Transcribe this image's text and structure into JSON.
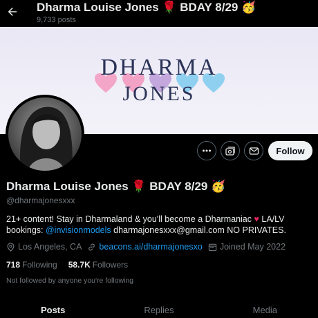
{
  "header": {
    "title": "Dharma Louise Jones 🌹 BDAY 8/29 🥳",
    "posts_count": "9,733 posts"
  },
  "banner": {
    "line1": "DHARMA",
    "line2": "JONES",
    "heart_colors": [
      "#f4a6c8",
      "#f4a6c8",
      "#c3a7dd",
      "#8fd0f0",
      "#8fd0f0"
    ]
  },
  "profile": {
    "display_name": "Dharma Louise Jones 🌹 BDAY 8/29 🥳",
    "handle": "@dharmajonesxxx",
    "bio_part1": "21+ content! Stay in Dharmaland & you'll become a Dharmaniac ",
    "bio_heart": "♥",
    "bio_part2": " LA/LV bookings: ",
    "bio_mention": "@invisionmodels",
    "bio_part3": " dharmajonesxxx@gmail.com NO PRIVATES.",
    "location": "Los Angeles, CA",
    "website": "beacons.ai/dharmajonesxo",
    "joined": "Joined May 2022",
    "following_count": "718",
    "following_label": "Following",
    "followers_count": "58.7K",
    "followers_label": "Followers",
    "not_followed_text": "Not followed by anyone you're following"
  },
  "actions": {
    "follow_label": "Follow",
    "more_icon": "more-icon",
    "subscribe_icon": "subscribe-icon",
    "message_icon": "message-icon"
  },
  "tabs": [
    {
      "label": "Posts",
      "active": true
    },
    {
      "label": "Replies",
      "active": false
    },
    {
      "label": "Media",
      "active": false
    }
  ],
  "colors": {
    "background": "#000000",
    "link": "#1d9bf0",
    "muted": "#71767b",
    "text": "#e7e9ea",
    "banner_text": "#2b3358"
  }
}
